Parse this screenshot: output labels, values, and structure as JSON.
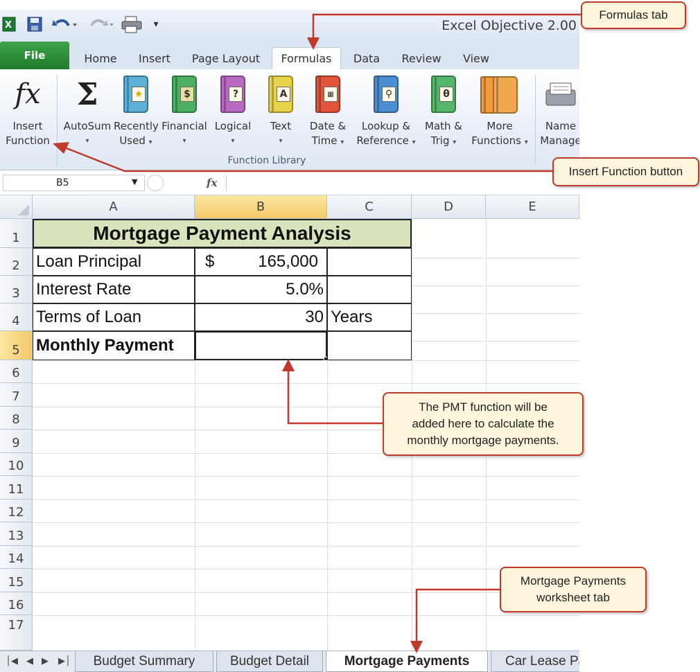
{
  "window": {
    "title": "Excel Objective 2.00"
  },
  "ribbon_tabs": [
    "File",
    "Home",
    "Insert",
    "Page Layout",
    "Formulas",
    "Data",
    "Review",
    "View"
  ],
  "ribbon": {
    "insert_function": {
      "line1": "Insert",
      "line2": "Function"
    },
    "autosum": {
      "line1": "AutoSum"
    },
    "recently_used": {
      "line1": "Recently",
      "line2": "Used"
    },
    "financial": {
      "line1": "Financial"
    },
    "logical": {
      "line1": "Logical"
    },
    "text": {
      "line1": "Text"
    },
    "date_time": {
      "line1": "Date &",
      "line2": "Time"
    },
    "lookup": {
      "line1": "Lookup &",
      "line2": "Reference"
    },
    "math": {
      "line1": "Math &",
      "line2": "Trig"
    },
    "more": {
      "line1": "More",
      "line2": "Functions"
    },
    "name_manager": {
      "line1": "Name",
      "line2": "Manage"
    },
    "group_label": "Function Library"
  },
  "formula_bar": {
    "name_box": "B5",
    "fx": "fx"
  },
  "columns": [
    "A",
    "B",
    "C",
    "D",
    "E"
  ],
  "rows": [
    "1",
    "2",
    "3",
    "4",
    "5",
    "6",
    "7",
    "8",
    "9",
    "10",
    "11",
    "12",
    "13",
    "14",
    "15",
    "16",
    "17"
  ],
  "sheet": {
    "title": "Mortgage Payment Analysis",
    "a2": "Loan Principal",
    "b2_symbol": "$",
    "b2_value": "165,000",
    "a3": "Interest Rate",
    "b3": "5.0%",
    "a4": "Terms of Loan",
    "b4": "30",
    "c4": "Years",
    "a5": "Monthly Payment"
  },
  "sheet_tabs": [
    "Budget Summary",
    "Budget Detail",
    "Mortgage Payments",
    "Car Lease Pa"
  ],
  "callouts": {
    "formulas_tab": "Formulas tab",
    "insert_function": "Insert Function button",
    "pmt": [
      "The PMT function will be",
      "added here to calculate the",
      "monthly mortgage payments."
    ],
    "mortgage_tab": [
      "Mortgage Payments",
      "worksheet tab"
    ]
  },
  "colors": {
    "accent": "#c0392b",
    "title_fill": "#d7e4bc",
    "callout_fill": "#fdf5dc",
    "file_tab": "#2a8c36"
  }
}
